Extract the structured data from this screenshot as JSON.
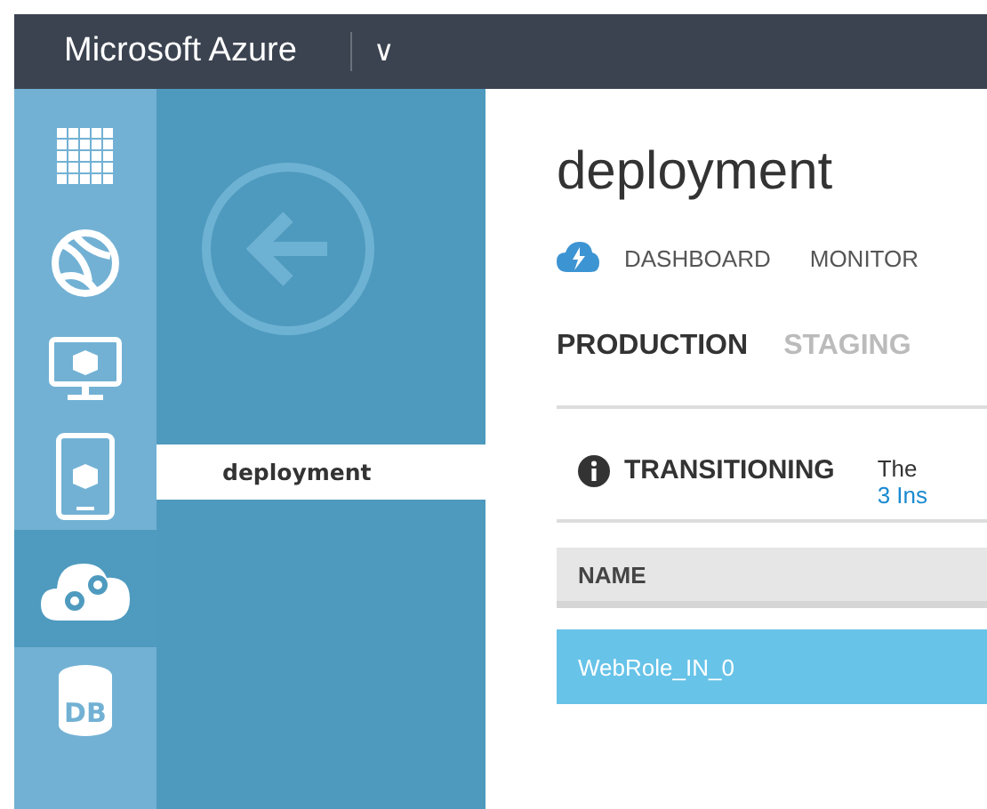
{
  "header": {
    "title": "Microsoft Azure",
    "menu_glyph": "∨"
  },
  "nav": [
    {
      "kind": "grid",
      "selected": false
    },
    {
      "kind": "globe",
      "selected": false
    },
    {
      "kind": "monitor",
      "selected": false
    },
    {
      "kind": "tablet",
      "selected": false
    },
    {
      "kind": "cloud",
      "selected": true
    },
    {
      "kind": "db",
      "selected": false,
      "label": "DB"
    }
  ],
  "subnav": {
    "items": [
      {
        "label": "deployment",
        "selected": true
      }
    ]
  },
  "page": {
    "title": "deployment",
    "tabs": [
      {
        "label": "DASHBOARD",
        "selected": false
      },
      {
        "label": "MONITOR",
        "selected": false
      }
    ],
    "env_tabs": [
      {
        "label": "PRODUCTION",
        "selected": true
      },
      {
        "label": "STAGING",
        "selected": false
      }
    ],
    "status": {
      "label": "TRANSITIONING",
      "text": "The",
      "link": "3 Ins"
    },
    "table": {
      "columns": [
        "NAME"
      ],
      "rows": [
        {
          "cells": [
            "WebRole_IN_0"
          ],
          "selected": true
        }
      ]
    }
  }
}
